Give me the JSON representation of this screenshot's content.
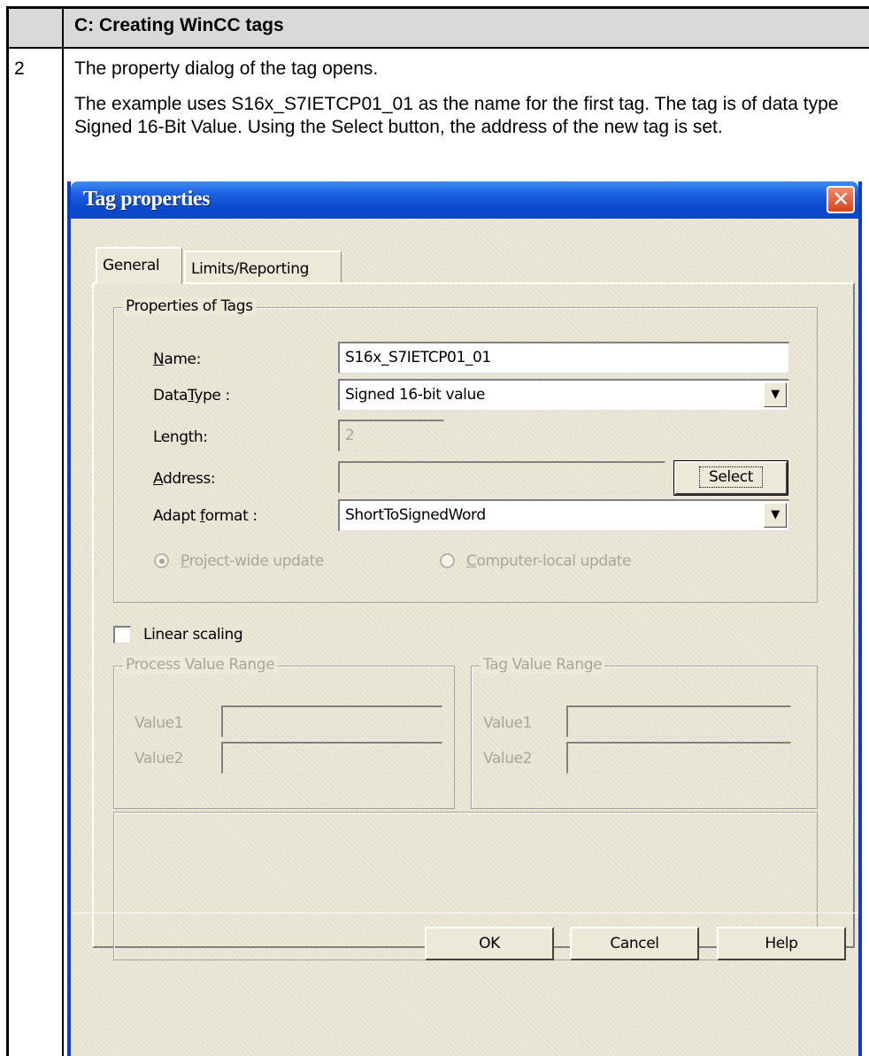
{
  "document": {
    "section_title": "C: Creating WinCC tags",
    "step_number": "2",
    "paragraph1": "The property dialog of the tag opens.",
    "paragraph2": "The example uses S16x_S7IETCP01_01 as the name for the first tag. The tag is of data type Signed 16-Bit Value. Using the Select button, the address of the new tag is set."
  },
  "dialog": {
    "title": "Tag properties",
    "close_icon": "close-x-icon",
    "tabs": [
      "General",
      "Limits/Reporting"
    ],
    "active_tab": "General",
    "properties_group": {
      "label": "Properties of Tags",
      "name_label": "Name:",
      "name_value": "S16x_S7IETCP01_01",
      "datatype_label": "DataType :",
      "datatype_value": "Signed 16-bit value",
      "length_label": "Length:",
      "length_value": "2",
      "address_label": "Address:",
      "address_value": "",
      "select_button": "Select",
      "adapt_label": "Adapt format :",
      "adapt_value": "ShortToSignedWord",
      "radio_project": "Project-wide update",
      "radio_computer": "Computer-local update",
      "radio_selected": "Project-wide update"
    },
    "linear_scaling": {
      "label": "Linear scaling",
      "checked": false
    },
    "process_range": {
      "label": "Process Value Range",
      "value1_label": "Value1",
      "value2_label": "Value2"
    },
    "tag_range": {
      "label": "Tag Value Range",
      "value1_label": "Value1",
      "value2_label": "Value2"
    },
    "buttons": {
      "ok": "OK",
      "cancel": "Cancel",
      "help": "Help"
    }
  }
}
